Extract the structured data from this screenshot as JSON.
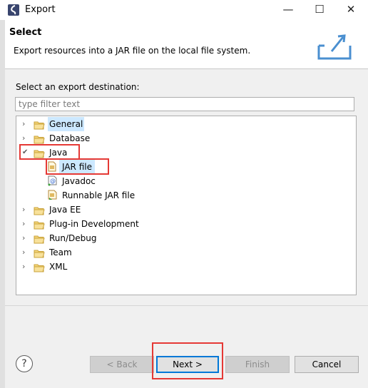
{
  "window": {
    "title": "Export",
    "minimize": "—",
    "maximize": "☐",
    "close": "✕"
  },
  "header": {
    "title": "Select",
    "description": "Export resources into a JAR file on the local file system."
  },
  "destination": {
    "label": "Select an export destination:",
    "filter_placeholder": "type filter text"
  },
  "tree": {
    "items": [
      {
        "label": "General",
        "expanded": false
      },
      {
        "label": "Database",
        "expanded": false
      },
      {
        "label": "Java",
        "expanded": true,
        "children": [
          {
            "label": "JAR file",
            "selected": true
          },
          {
            "label": "Javadoc"
          },
          {
            "label": "Runnable JAR file"
          }
        ]
      },
      {
        "label": "Java EE",
        "expanded": false
      },
      {
        "label": "Plug-in Development",
        "expanded": false
      },
      {
        "label": "Run/Debug",
        "expanded": false
      },
      {
        "label": "Team",
        "expanded": false
      },
      {
        "label": "XML",
        "expanded": false
      }
    ]
  },
  "buttons": {
    "help": "?",
    "back": "< Back",
    "next": "Next >",
    "finish": "Finish",
    "cancel": "Cancel"
  },
  "colors": {
    "selection": "#cce8ff",
    "highlight_box": "#e53935",
    "default_button": "#0078d7"
  }
}
